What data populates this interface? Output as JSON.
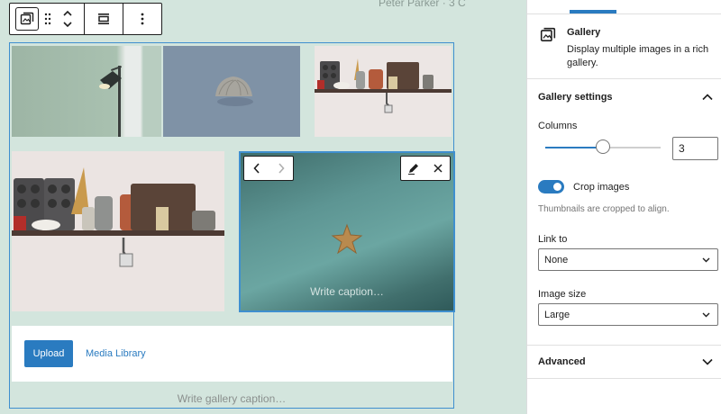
{
  "canvas": {
    "author_hint": "Peter Parker · 3 C",
    "gallery_caption_placeholder": "Write gallery caption…",
    "image_caption_placeholder": "Write caption…",
    "upload_label": "Upload",
    "media_library_label": "Media Library",
    "toolbar": {
      "icons": [
        "gallery-icon",
        "drag-handle-icon",
        "move-up-down-icon",
        "align-icon",
        "more-options-icon"
      ]
    }
  },
  "sidebar": {
    "block": {
      "title": "Gallery",
      "description": "Display multiple images in a rich gallery."
    },
    "gallery_settings": {
      "title": "Gallery settings",
      "columns_label": "Columns",
      "columns_value": "3",
      "columns_slider_fraction": 0.5,
      "crop_label": "Crop images",
      "crop_on": true,
      "crop_help": "Thumbnails are cropped to align.",
      "link_label": "Link to",
      "link_value": "None",
      "size_label": "Image size",
      "size_value": "Large"
    },
    "advanced": {
      "title": "Advanced"
    }
  },
  "colors": {
    "accent": "#2a7bc0",
    "canvas_bg": "#d3e5dd"
  }
}
